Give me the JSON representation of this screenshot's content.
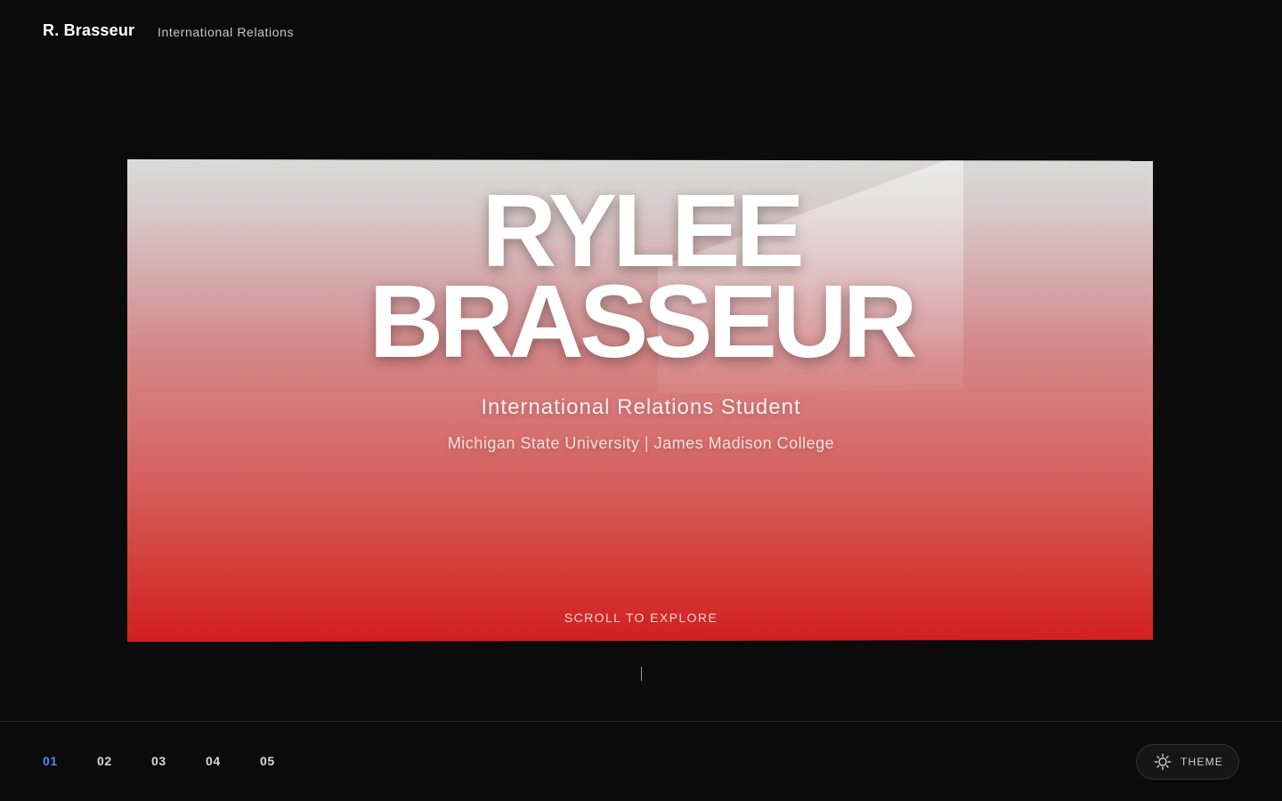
{
  "header": {
    "brand": "R. Brasseur",
    "subtitle": "International Relations"
  },
  "hero": {
    "title_line1": "RYLEE",
    "title_line2": "BRASSEUR",
    "subtitle": "International Relations Student",
    "school": "Michigan State University | James Madison College",
    "scroll_cta": "SCROLL TO EXPLORE"
  },
  "footer": {
    "nav": [
      "01",
      "02",
      "03",
      "04",
      "05"
    ],
    "active_nav": "01",
    "theme_label": "THEME",
    "theme_icon": "sun-icon"
  },
  "colors": {
    "background": "#0b0b0b",
    "accent": "#4d8ee8",
    "hero_top": "#dadada",
    "hero_bottom": "#d21f20"
  }
}
